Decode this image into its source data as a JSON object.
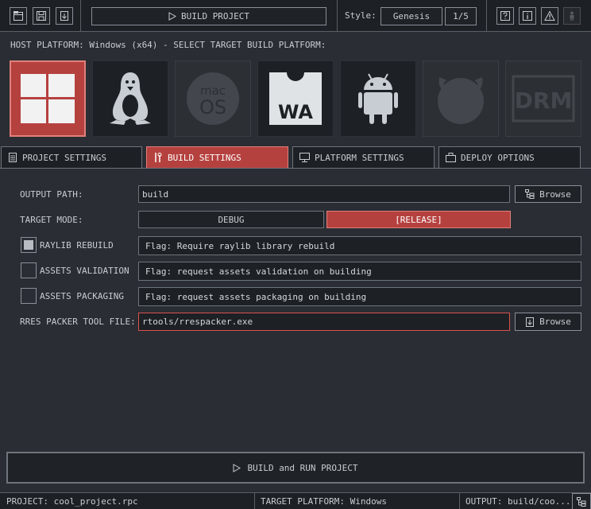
{
  "toolbar": {
    "build_project_label": "BUILD PROJECT",
    "style_label": "Style:",
    "style_value": "Genesis",
    "style_page": "1/5",
    "icons": [
      "new-file-icon",
      "save-icon",
      "export-icon",
      "help-icon",
      "info-icon",
      "warning-icon",
      "user-icon"
    ]
  },
  "host_platform_text": "HOST PLATFORM: Windows (x64) - SELECT TARGET BUILD PLATFORM:",
  "platforms": [
    {
      "name": "Windows",
      "state": "selected"
    },
    {
      "name": "Linux",
      "state": "enabled"
    },
    {
      "name": "macOS",
      "state": "disabled",
      "text_top": "mac",
      "text_bottom": "OS"
    },
    {
      "name": "WebAssembly",
      "state": "enabled",
      "text": "WA"
    },
    {
      "name": "Android",
      "state": "enabled"
    },
    {
      "name": "FreeBSD",
      "state": "disabled"
    },
    {
      "name": "DRM",
      "state": "disabled",
      "text": "DRM"
    }
  ],
  "tabs": [
    {
      "label": "PROJECT SETTINGS",
      "active": false
    },
    {
      "label": "BUILD SETTINGS",
      "active": true
    },
    {
      "label": "PLATFORM SETTINGS",
      "active": false
    },
    {
      "label": "DEPLOY OPTIONS",
      "active": false
    }
  ],
  "build": {
    "output_path_label": "OUTPUT PATH:",
    "output_path_value": "build",
    "browse_label": "Browse",
    "target_mode_label": "TARGET MODE:",
    "mode_debug": "DEBUG",
    "mode_release": "[RELEASE]",
    "selected_mode": "RELEASE",
    "flags": [
      {
        "label": "RAYLIB REBUILD",
        "checked": true,
        "description": "Flag: Require raylib library rebuild"
      },
      {
        "label": "ASSETS VALIDATION",
        "checked": false,
        "description": "Flag: request assets validation on building"
      },
      {
        "label": "ASSETS PACKAGING",
        "checked": false,
        "description": "Flag: request assets packaging on building"
      }
    ],
    "rres_label": "RRES PACKER TOOL FILE:",
    "rres_value": "rtools/rrespacker.exe",
    "rres_browse_label": "Browse"
  },
  "build_run_label": "BUILD and RUN PROJECT",
  "status": {
    "project": "PROJECT: cool_project.rpc",
    "target_platform": "TARGET PLATFORM: Windows",
    "output": "OUTPUT: build/coo..."
  },
  "colors": {
    "accent": "#b5413f",
    "accent_border": "#e0807c",
    "background": "#2a2d33",
    "panel": "#1d2024",
    "text": "#c8cdd3"
  }
}
